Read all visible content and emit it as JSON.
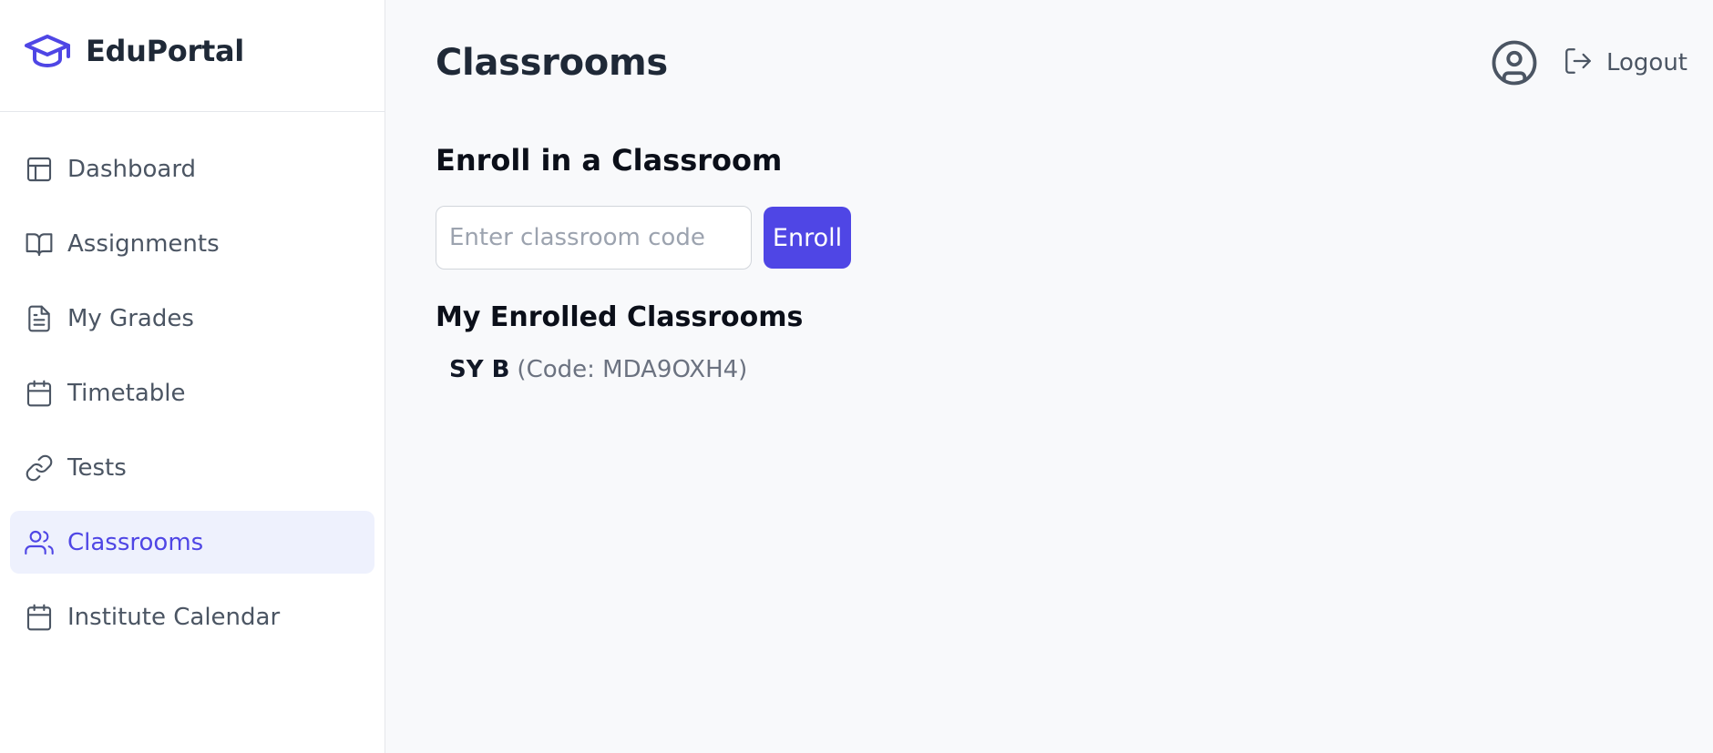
{
  "brand": {
    "name": "EduPortal",
    "accent": "#4f46e5"
  },
  "sidebar": {
    "items": [
      {
        "label": "Dashboard",
        "icon": "layout-icon",
        "active": false
      },
      {
        "label": "Assignments",
        "icon": "book-open-icon",
        "active": false
      },
      {
        "label": "My Grades",
        "icon": "file-text-icon",
        "active": false
      },
      {
        "label": "Timetable",
        "icon": "calendar-icon",
        "active": false
      },
      {
        "label": "Tests",
        "icon": "link-icon",
        "active": false
      },
      {
        "label": "Classrooms",
        "icon": "users-icon",
        "active": true
      },
      {
        "label": "Institute Calendar",
        "icon": "calendar-icon",
        "active": false
      }
    ]
  },
  "header": {
    "title": "Classrooms",
    "logout_label": "Logout"
  },
  "enroll": {
    "heading": "Enroll in a Classroom",
    "placeholder": "Enter classroom code",
    "value": "",
    "button_label": "Enroll"
  },
  "enrolled": {
    "heading": "My Enrolled Classrooms",
    "classrooms": [
      {
        "name": "SY B",
        "code_text": "(Code: MDA9OXH4)"
      }
    ]
  }
}
